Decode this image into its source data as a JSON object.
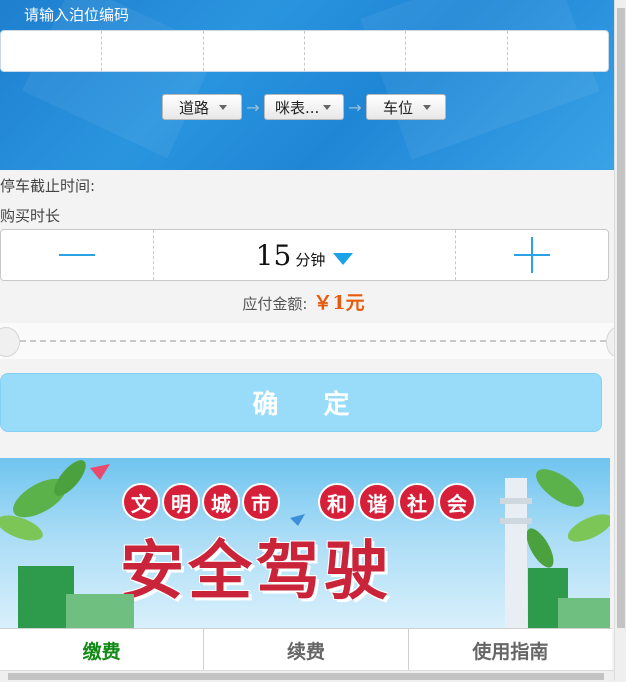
{
  "header": {
    "title": "请输入泊位编码",
    "code_cells": [
      "",
      "",
      "",
      "",
      "",
      ""
    ]
  },
  "selectors": {
    "road": "道路",
    "meter": "咪表...",
    "space": "车位",
    "arrow": "→"
  },
  "info": {
    "deadline_label": "停车截止时间:",
    "buy_label": "购买时长"
  },
  "duration": {
    "value": "15",
    "unit": "分钟"
  },
  "payment": {
    "label": "应付金额:",
    "amount": "￥1元"
  },
  "confirm_label": "确 定",
  "banner": {
    "slogan_chars": [
      "文",
      "明",
      "城",
      "市",
      "和",
      "谐",
      "社",
      "会"
    ],
    "headline": "安全驾驶"
  },
  "tabs": [
    "缴费",
    "续费",
    "使用指南"
  ],
  "colors": {
    "accent": "#29a3e6",
    "amount": "#e85a0c",
    "confirm_bg": "#99dcfa",
    "active_tab": "#118a15"
  }
}
